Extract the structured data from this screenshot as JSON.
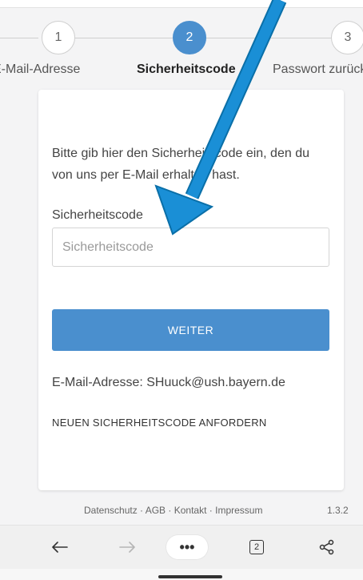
{
  "stepper": {
    "steps": [
      {
        "number": "1",
        "label": "E-Mail-Adresse"
      },
      {
        "number": "2",
        "label": "Sicherheitscode"
      },
      {
        "number": "3",
        "label": "Passwort zurücksetzen"
      }
    ],
    "active_step": 2
  },
  "form": {
    "intro_text": "Bitte gib hier den Sicherheitscode ein, den du von uns per E-Mail erhalten hast.",
    "field_label": "Sicherheitscode",
    "input_placeholder": "Sicherheitscode",
    "input_value": "",
    "submit_label": "WEITER",
    "email_line": "E-Mail-Adresse: SHuuck@ush.bayern.de",
    "resend_link": "NEUEN SICHERHEITSCODE ANFORDERN"
  },
  "footer": {
    "links": [
      "Datenschutz",
      "AGB",
      "Kontakt",
      "Impressum"
    ],
    "separator": " · ",
    "version": "1.3.2"
  },
  "browser_toolbar": {
    "back_icon": "arrow-left-icon",
    "forward_icon": "arrow-right-icon",
    "menu_label": "•••",
    "tab_count": "2",
    "share_icon": "share-icon"
  },
  "colors": {
    "accent": "#4a8fce",
    "annotation_arrow": "#1a8fd6"
  }
}
